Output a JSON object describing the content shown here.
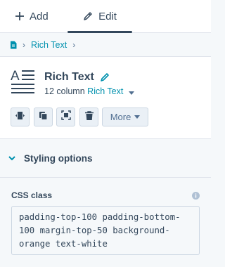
{
  "tabs": {
    "add_label": "Add",
    "edit_label": "Edit"
  },
  "breadcrumb": {
    "item": "Rich Text"
  },
  "module": {
    "title": "Rich Text",
    "column_prefix": "12 column",
    "column_type": "Rich Text"
  },
  "toolbar": {
    "more_label": "More"
  },
  "styling": {
    "label": "Styling options"
  },
  "css_class": {
    "label": "CSS class",
    "value": "padding-top-100 padding-bottom-100 margin-top-50 background-orange text-white"
  },
  "colors": {
    "link": "#0091ae",
    "text": "#33475b",
    "button_bg": "#eaf0f6"
  }
}
